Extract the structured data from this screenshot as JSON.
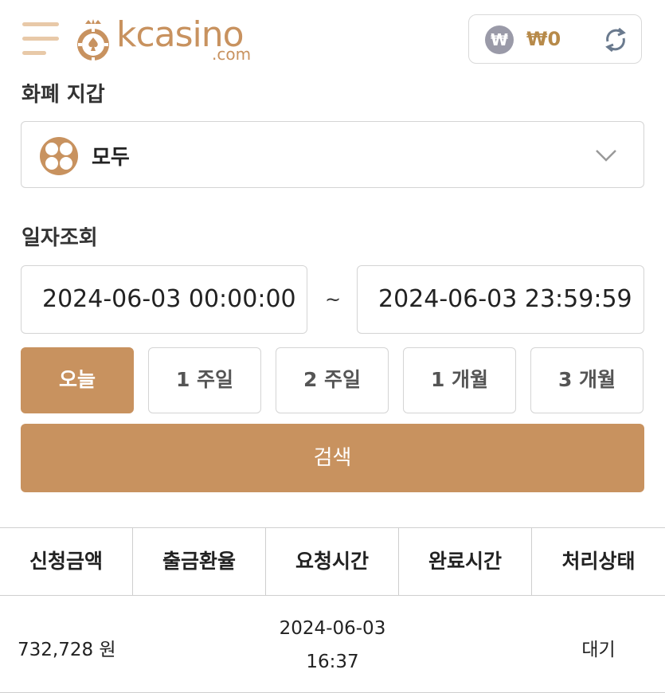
{
  "header": {
    "brand": "kcasino",
    "brand_domain": ".com",
    "currency_symbol": "₩",
    "balance": "₩0"
  },
  "wallet_section": {
    "label": "화폐 지갑",
    "selected": "모두"
  },
  "date_section": {
    "label": "일자조회",
    "start": "2024-06-03 00:00:00",
    "separator": "~",
    "end": "2024-06-03 23:59:59"
  },
  "periods": [
    "오늘",
    "1 주일",
    "2 주일",
    "1 개월",
    "3 개월"
  ],
  "active_period": "오늘",
  "search_label": "검색",
  "table": {
    "headers": [
      "신청금액",
      "출금환율",
      "요청시간",
      "완료시간",
      "처리상태"
    ],
    "rows": [
      {
        "amount": "732,728 원",
        "rate": "",
        "request_date": "2024-06-03",
        "request_time": "16:37",
        "completed": "",
        "status": "대기"
      }
    ]
  },
  "colors": {
    "accent": "#c8925f",
    "menu": "#e8c9a8",
    "balance": "#b78a4a",
    "border": "#d4d4d4"
  }
}
